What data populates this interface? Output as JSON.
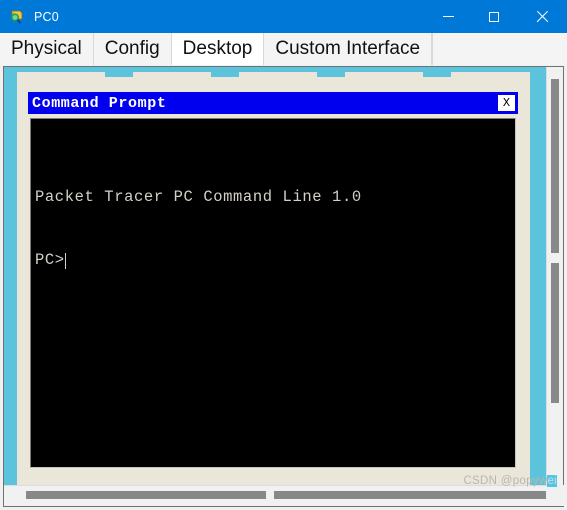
{
  "window": {
    "title": "PC0",
    "icon": "packet-tracer-pc-icon",
    "controls": {
      "minimize_label": "Minimize",
      "maximize_label": "Maximize",
      "close_label": "Close"
    }
  },
  "tabs": [
    {
      "label": "Physical",
      "active": false
    },
    {
      "label": "Config",
      "active": false
    },
    {
      "label": "Desktop",
      "active": true
    },
    {
      "label": "Custom Interface",
      "active": false
    }
  ],
  "command_prompt": {
    "title": "Command Prompt",
    "close_label": "X",
    "lines": [
      "Packet Tracer PC Command Line 1.0",
      "PC>"
    ],
    "banner": "Packet Tracer PC Command Line 1.0",
    "prompt": "PC>",
    "cursor_visible": true
  },
  "scrollbars": {
    "vertical_present": true,
    "horizontal_present": true
  },
  "watermark": {
    "text": "CSDN @popywei",
    "prefix": "CSDN @popyw",
    "highlight": "ei"
  },
  "colors": {
    "titlebar_blue": "#0078d7",
    "cmd_titlebar_blue": "#0000ee",
    "cyan_background": "#5bc3dc",
    "beige_panel": "#eae7da",
    "terminal_background": "#000000",
    "terminal_text": "#d4d0c8"
  }
}
